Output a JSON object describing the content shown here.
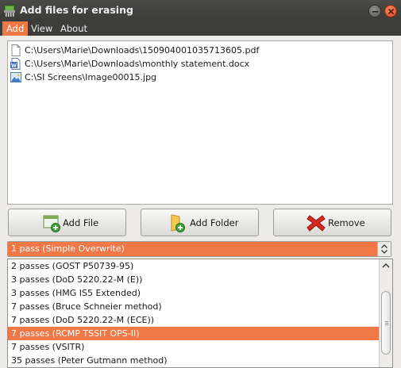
{
  "window": {
    "title": "Add files for erasing"
  },
  "menu": {
    "items": [
      "Add",
      "View",
      "About"
    ]
  },
  "files": [
    {
      "icon": "pdf-file-icon",
      "path": "C:\\Users\\Marie\\Downloads\\150904001035713605.pdf"
    },
    {
      "icon": "docx-file-icon",
      "path": "C:\\Users\\Marie\\Downloads\\monthly statement.docx"
    },
    {
      "icon": "image-file-icon",
      "path": "C:\\SI Screens\\Image00015.jpg"
    }
  ],
  "buttons": {
    "add_file": "Add File",
    "add_folder": "Add Folder",
    "remove": "Remove"
  },
  "method": {
    "selected": "1 pass (Simple Overwrite)",
    "options": [
      "2 passes (GOST P50739-95)",
      "3 passes (DoD 5220.22-M (E))",
      "3 passes (HMG IS5 Extended)",
      "7 passes (Bruce Schneier method)",
      "7 passes (DoD 5220.22-M (ECE))",
      "7 passes (RCMP TSSIT OPS-II)",
      "7 passes (VSITR)",
      "35 passes (Peter Gutmann method)"
    ],
    "highlighted": "7 passes (RCMP TSSIT OPS-II)"
  },
  "colors": {
    "accent": "#f07746",
    "titlebar": "#3c3c3b"
  }
}
